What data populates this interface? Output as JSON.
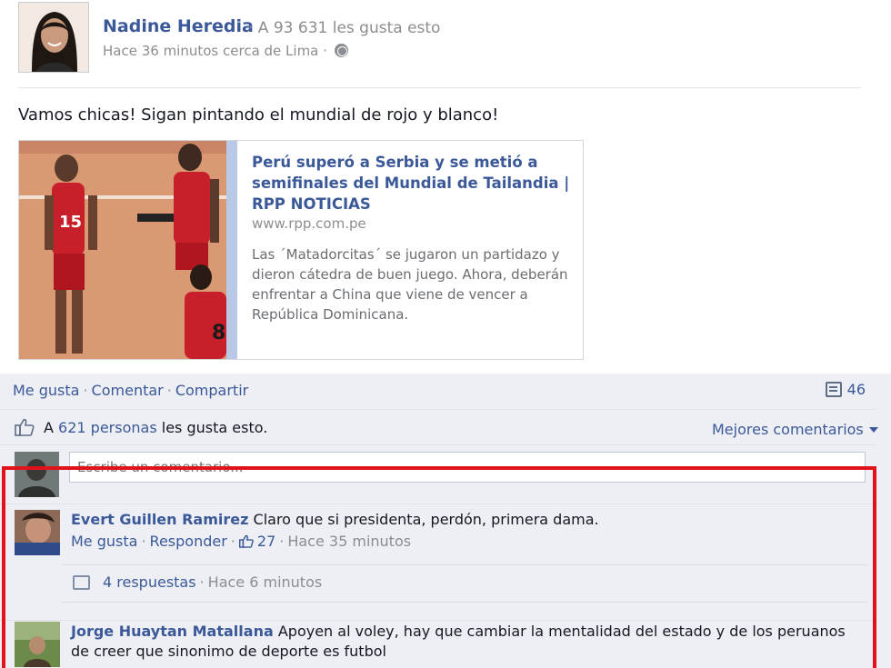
{
  "post": {
    "author": "Nadine Heredia",
    "page_likes": "· A 93 631 les gusta esto",
    "meta": "Hace 36 minutos cerca de Lima ·",
    "text": "Vamos chicas! Sigan pintando el mundial de rojo y blanco!",
    "link": {
      "title": "Perú superó a Serbia y se metió a semifinales del Mundial de Tailandia | RPP NOTICIAS",
      "domain": "www.rpp.com.pe",
      "description": "Las ´Matadorcitas´ se jugaron un partidazo y dieron cátedra de buen juego. Ahora, deberán enfrentar a China que viene de vencer a República Dominicana."
    }
  },
  "actions": {
    "like": "Me gusta",
    "comment": "Comentar",
    "share": "Compartir",
    "count": "46"
  },
  "likes_summary": {
    "prefix": "A",
    "people": "621 personas",
    "suffix": "les gusta esto."
  },
  "sort_label": "Mejores comentarios",
  "comment_box": {
    "placeholder": "Escribe un comentario..."
  },
  "comments": [
    {
      "name": "Evert Guillen Ramirez",
      "text": "Claro que si presidenta, perdón, primera dama.",
      "like": "Me gusta",
      "reply": "Responder",
      "likes": "27",
      "time": "Hace 35 minutos",
      "replies": "4 respuestas",
      "replies_time": "Hace 6 minutos"
    },
    {
      "name": "Jorge Huaytan Matallana",
      "text": "Apoyen al voley, hay que cambiar la mentalidad del estado y de los peruanos de creer que sinonimo de deporte es futbol"
    }
  ],
  "colors": {
    "link": "#3b5998",
    "highlight": "#e0121c",
    "feedback_bg": "#edeff4"
  },
  "icons": [
    "globe-icon",
    "share-count-icon",
    "like-thumb-icon",
    "dropdown-caret-icon",
    "reply-icon"
  ]
}
